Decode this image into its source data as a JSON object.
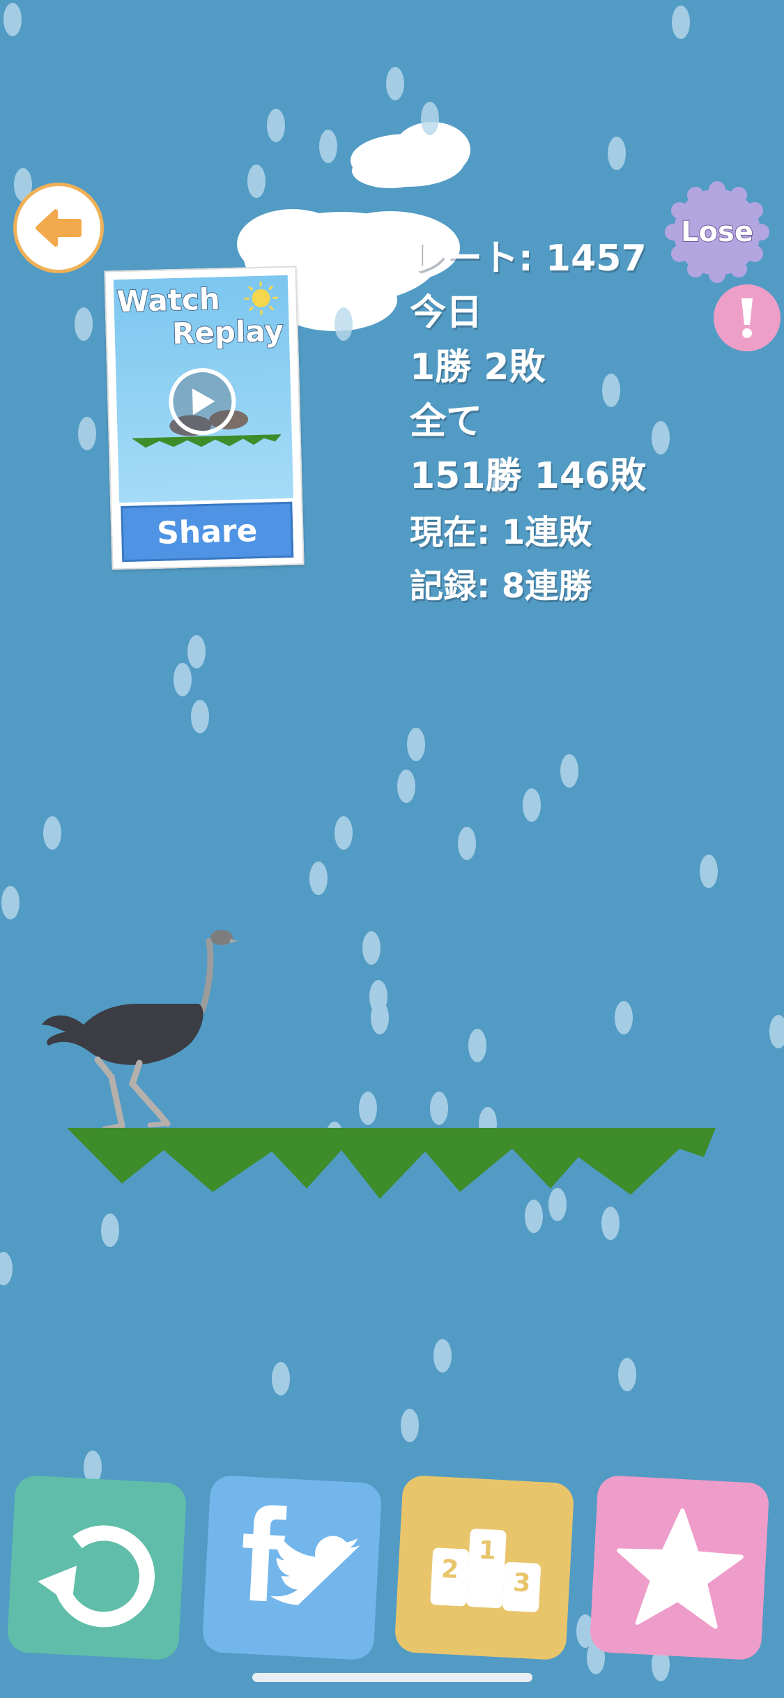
{
  "colors": {
    "sky": "#529bc4",
    "grass": "#3e8c2a",
    "back_ring": "#efb057",
    "lose_badge": "#b3a5e0",
    "alert": "#ee9fc8",
    "btn_retry": "#5fbda9",
    "btn_social": "#73b6ec",
    "btn_ranking": "#e8c56b",
    "btn_favorite": "#ee9cc9"
  },
  "back_button": {
    "icon": "arrow-left-icon"
  },
  "replay": {
    "title_line1": "Watch",
    "title_line2": "Replay",
    "share_label": "Share",
    "icon": "play-icon"
  },
  "result_badge": {
    "label": "Lose"
  },
  "alert_button": {
    "icon": "exclamation-icon"
  },
  "stats": {
    "rate": "レート: 1457",
    "today_label": "今日",
    "today_record": "1勝 2敗",
    "all_label": "全て",
    "all_record": "151勝 146敗",
    "current_streak": "現在: 1連敗",
    "best_streak": "記録: 8連勝"
  },
  "bottom_bar": {
    "buttons": [
      {
        "name": "retry-button",
        "icon": "retry-icon"
      },
      {
        "name": "social-share-button",
        "icon": "facebook-twitter-icon"
      },
      {
        "name": "ranking-button",
        "icon": "podium-icon",
        "podium": [
          "2",
          "1",
          "3"
        ]
      },
      {
        "name": "favorite-button",
        "icon": "star-icon"
      }
    ]
  }
}
